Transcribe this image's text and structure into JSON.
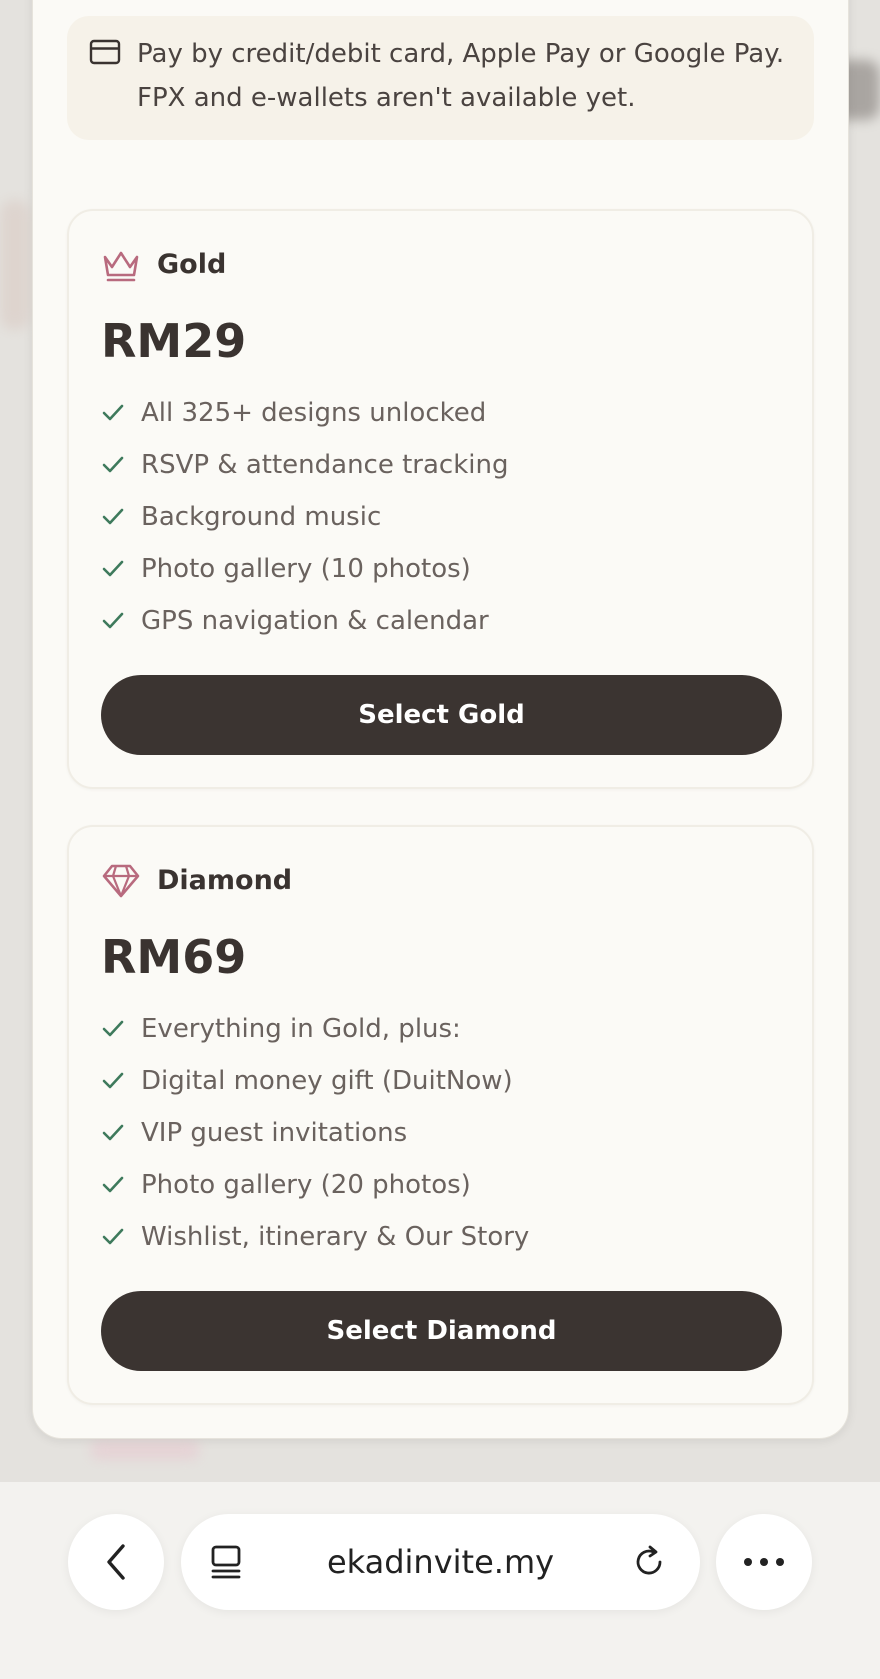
{
  "notice": {
    "icon": "credit-card-icon",
    "text": "Pay by credit/debit card, Apple Pay or Google Pay. FPX and e-wallets aren't available yet."
  },
  "plans": [
    {
      "icon": "crown-icon",
      "name": "Gold",
      "price": "RM29",
      "features": [
        "All 325+ designs unlocked",
        "RSVP & attendance tracking",
        "Background music",
        "Photo gallery (10 photos)",
        "GPS navigation & calendar"
      ],
      "button_label": "Select Gold"
    },
    {
      "icon": "diamond-icon",
      "name": "Diamond",
      "price": "RM69",
      "features": [
        "Everything in Gold, plus:",
        "Digital money gift (DuitNow)",
        "VIP guest invitations",
        "Photo gallery (20 photos)",
        "Wishlist, itinerary & Our Story"
      ],
      "button_label": "Select Diamond"
    }
  ],
  "browser": {
    "url": "ekadinvite.my",
    "back_icon": "chevron-left-icon",
    "tabs_icon": "tabs-icon",
    "reload_icon": "reload-icon",
    "more_icon": "more-icon"
  },
  "colors": {
    "accent": "#b86a7e",
    "check": "#3e7a5c",
    "button": "#3b3431",
    "card_bg": "#fbfaf6"
  }
}
